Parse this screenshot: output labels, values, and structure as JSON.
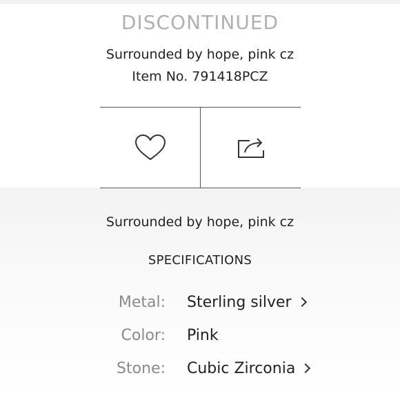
{
  "product": {
    "status": "DISCONTINUED",
    "title": "Surrounded by hope, pink cz",
    "item_number": "Item No. 791418PCZ",
    "description": "Surrounded by hope, pink cz"
  },
  "actions": {
    "favorite_icon": "heart-icon",
    "share_icon": "share-icon"
  },
  "specifications": {
    "heading": "SPECIFICATIONS",
    "rows": [
      {
        "label": "Metal:",
        "value": "Sterling silver",
        "has_link": true
      },
      {
        "label": "Color:",
        "value": "Pink",
        "has_link": false
      },
      {
        "label": "Stone:",
        "value": "Cubic Zirconia",
        "has_link": true
      }
    ]
  },
  "colors": {
    "status_text": "#b0b0b0",
    "label_text": "#8a8a8a",
    "body_text": "#222222",
    "divider": "#555555"
  }
}
